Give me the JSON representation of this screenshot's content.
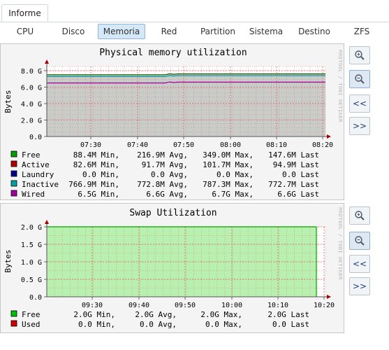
{
  "main_tab": {
    "label": "Informe"
  },
  "subtabs": [
    {
      "label": "CPU",
      "active": false
    },
    {
      "label": "Disco",
      "active": false
    },
    {
      "label": "Memoria",
      "active": true
    },
    {
      "label": "Red",
      "active": false
    },
    {
      "label": "Partition",
      "active": false
    },
    {
      "label": "Sistema",
      "active": false
    },
    {
      "label": "Destino",
      "active": false
    },
    {
      "label": "ZFS",
      "active": false
    }
  ],
  "graphs": [
    {
      "title": "Physical memory utilization",
      "ylabel": "Bytes",
      "watermark": "RRDTOOL / TOBI OETIKER",
      "legend": [
        {
          "name": "Free",
          "color": "#00a000",
          "min": "88.4M Min,",
          "avg": "216.9M Avg,",
          "max": "349.0M Max,",
          "last": "147.6M Last"
        },
        {
          "name": "Active",
          "color": "#b00000",
          "min": "82.6M Min,",
          "avg": "91.7M Avg,",
          "max": "101.7M Max,",
          "last": "94.9M Last"
        },
        {
          "name": "Laundry",
          "color": "#00008c",
          "min": "0.0  Min,",
          "avg": "0.0  Avg,",
          "max": "0.0  Max,",
          "last": "0.0  Last"
        },
        {
          "name": "Inactive",
          "color": "#00a0a0",
          "min": "766.9M Min,",
          "avg": "772.8M Avg,",
          "max": "787.3M Max,",
          "last": "772.7M Last"
        },
        {
          "name": "Wired",
          "color": "#a000a0",
          "min": "6.5G Min,",
          "avg": "6.6G Avg,",
          "max": "6.7G Max,",
          "last": "6.6G Last"
        }
      ],
      "chart_data": {
        "type": "area",
        "title": "Physical memory utilization",
        "ylabel": "Bytes",
        "x_ticks": [
          "07:30",
          "07:40",
          "07:50",
          "08:00",
          "08:10",
          "08:20"
        ],
        "y_ticks": [
          "0.0",
          "2.0 G",
          "4.0 G",
          "6.0 G",
          "8.0 G"
        ],
        "ylim": [
          0,
          8.5
        ],
        "grid": true,
        "series": [
          {
            "name": "Wired",
            "color": "#a000a0",
            "values": [
              6.5,
              6.5,
              6.5,
              6.6,
              6.6,
              6.6
            ]
          },
          {
            "name": "Inactive",
            "color": "#00a0a0",
            "values": [
              7.3,
              7.3,
              7.3,
              7.4,
              7.4,
              7.4
            ]
          },
          {
            "name": "Free",
            "color": "#00a000",
            "values": [
              7.5,
              7.5,
              7.6,
              7.6,
              7.6,
              7.6
            ]
          }
        ]
      },
      "buttons": [
        {
          "label": "zoom-in"
        },
        {
          "label": "zoom-out"
        },
        {
          "label": "<<"
        },
        {
          "label": ">>"
        }
      ]
    },
    {
      "title": "Swap Utilization",
      "ylabel": "Bytes",
      "watermark": "RRDTOOL / TOBI OETIKER",
      "legend": [
        {
          "name": "Free",
          "color": "#00c000",
          "min": "2.0G Min,",
          "avg": "2.0G Avg,",
          "max": "2.0G Max,",
          "last": "2.0G Last"
        },
        {
          "name": "Used",
          "color": "#d00000",
          "min": "0.0  Min,",
          "avg": "0.0  Avg,",
          "max": "0.0  Max,",
          "last": "0.0  Last"
        }
      ],
      "chart_data": {
        "type": "area",
        "title": "Swap Utilization",
        "ylabel": "Bytes",
        "x_ticks": [
          "09:30",
          "09:40",
          "09:50",
          "10:00",
          "10:10",
          "10:20"
        ],
        "y_ticks": [
          "0.0",
          "0.5 G",
          "1.0 G",
          "1.5 G",
          "2.0 G"
        ],
        "ylim": [
          0,
          2.0
        ],
        "grid": true,
        "series": [
          {
            "name": "Free",
            "color": "#90ee90",
            "values": [
              2.0,
              2.0,
              2.0,
              2.0,
              2.0,
              2.0
            ]
          },
          {
            "name": "Used",
            "color": "#d00000",
            "values": [
              0,
              0,
              0,
              0,
              0,
              0
            ]
          }
        ]
      },
      "buttons": [
        {
          "label": "zoom-in"
        },
        {
          "label": "zoom-out"
        },
        {
          "label": "<<"
        },
        {
          "label": ">>"
        }
      ]
    }
  ]
}
